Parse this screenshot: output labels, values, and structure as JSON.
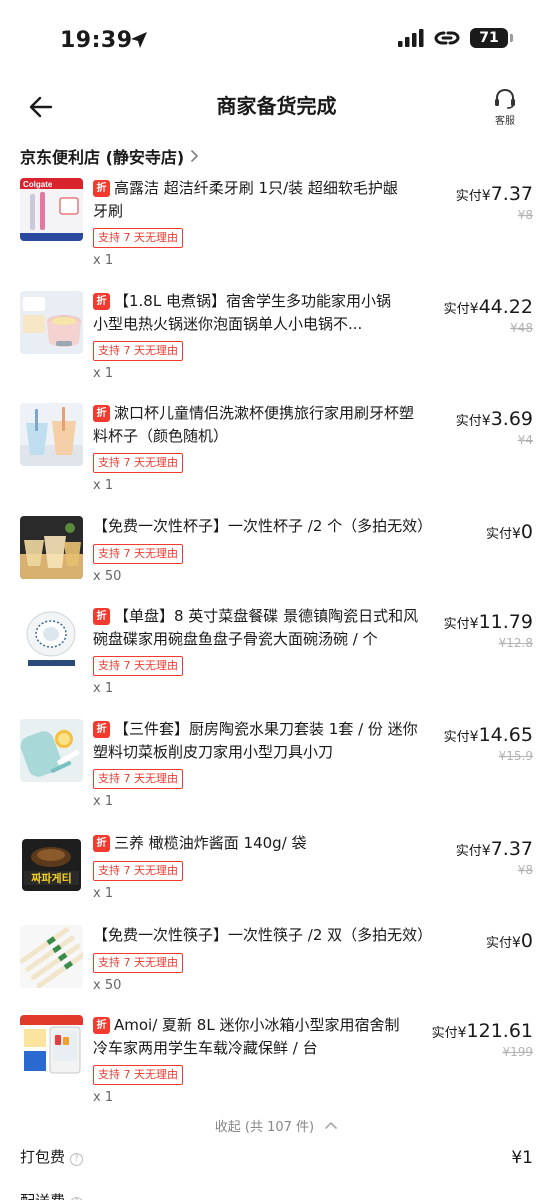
{
  "status_bar": {
    "time": "19:39",
    "battery": "71"
  },
  "header": {
    "title": "商家备货完成",
    "service_label": "客服"
  },
  "store": {
    "name": "京东便利店 (静安寺店)"
  },
  "items": [
    {
      "discount_tag": "折",
      "line1": "高露洁 超洁纤柔牙刷 1只/装 超细软毛护龈",
      "line2": "牙刷",
      "badge": "支持 7 天无理由",
      "qty": "x 1",
      "price_prefix": "实付",
      "currency": "¥",
      "price": "7.37",
      "orig_price": "¥8"
    },
    {
      "discount_tag": "折",
      "line1": "【1.8L 电煮锅】宿舍学生多功能家用小锅",
      "line2": "小型电热火锅迷你泡面锅单人小电锅不...",
      "badge": "支持 7 天无理由",
      "qty": "x 1",
      "price_prefix": "实付",
      "currency": "¥",
      "price": "44.22",
      "orig_price": "¥48"
    },
    {
      "discount_tag": "折",
      "line1": "漱口杯儿童情侣洗漱杯便携旅行家用刷牙杯塑",
      "line2": "料杯子（颜色随机）",
      "badge": "支持 7 天无理由",
      "qty": "x 1",
      "price_prefix": "实付",
      "currency": "¥",
      "price": "3.69",
      "orig_price": "¥4"
    },
    {
      "discount_tag": "",
      "line1": "【免费一次性杯子】一次性杯子 /2 个（多拍无效）",
      "line2": "",
      "badge": "支持 7 天无理由",
      "qty": "x 50",
      "price_prefix": "实付",
      "currency": "¥",
      "price": "0",
      "orig_price": ""
    },
    {
      "discount_tag": "折",
      "line1": "【单盘】8 英寸菜盘餐碟 景德镇陶瓷日式和风",
      "line2": "碗盘碟家用碗盘鱼盘子骨瓷大面碗汤碗 / 个",
      "badge": "支持 7 天无理由",
      "qty": "x 1",
      "price_prefix": "实付",
      "currency": "¥",
      "price": "11.79",
      "orig_price": "¥12.8"
    },
    {
      "discount_tag": "折",
      "line1": "【三件套】厨房陶瓷水果刀套装 1套 / 份 迷你",
      "line2": "塑料切菜板削皮刀家用小型刀具小刀",
      "badge": "支持 7 天无理由",
      "qty": "x 1",
      "price_prefix": "实付",
      "currency": "¥",
      "price": "14.65",
      "orig_price": "¥15.9"
    },
    {
      "discount_tag": "折",
      "line1": "三养 橄榄油炸酱面 140g/ 袋",
      "line2": "",
      "badge": "支持 7 天无理由",
      "qty": "x 1",
      "price_prefix": "实付",
      "currency": "¥",
      "price": "7.37",
      "orig_price": "¥8"
    },
    {
      "discount_tag": "",
      "line1": "【免费一次性筷子】一次性筷子 /2 双（多拍无效）",
      "line2": "",
      "badge": "支持 7 天无理由",
      "qty": "x 50",
      "price_prefix": "实付",
      "currency": "¥",
      "price": "0",
      "orig_price": ""
    },
    {
      "discount_tag": "折",
      "line1": "Amoi/ 夏新 8L 迷你小冰箱小型家用宿舍制",
      "line2": "冷车家两用学生车载冷藏保鲜 / 台",
      "badge": "支持 7 天无理由",
      "qty": "x 1",
      "price_prefix": "实付",
      "currency": "¥",
      "price": "121.61",
      "orig_price": "¥199"
    }
  ],
  "thumb_text": {
    "toothbrush_brand": "Colgate",
    "noodle_brand": "짜파게티"
  },
  "collapse_label": "收起 (共 107 件)",
  "fees": [
    {
      "label": "打包费",
      "value": "¥1"
    },
    {
      "label": "配送费",
      "value": ""
    }
  ],
  "colors": {
    "accent_red": "#f23a2f",
    "text": "#1a1a1a",
    "muted": "#888888"
  },
  "icons": [
    "back-arrow-icon",
    "headset-icon",
    "chevron-right-icon",
    "chevron-up-icon",
    "help-circle-icon",
    "signal-icon",
    "link-icon",
    "location-arrow-icon"
  ]
}
